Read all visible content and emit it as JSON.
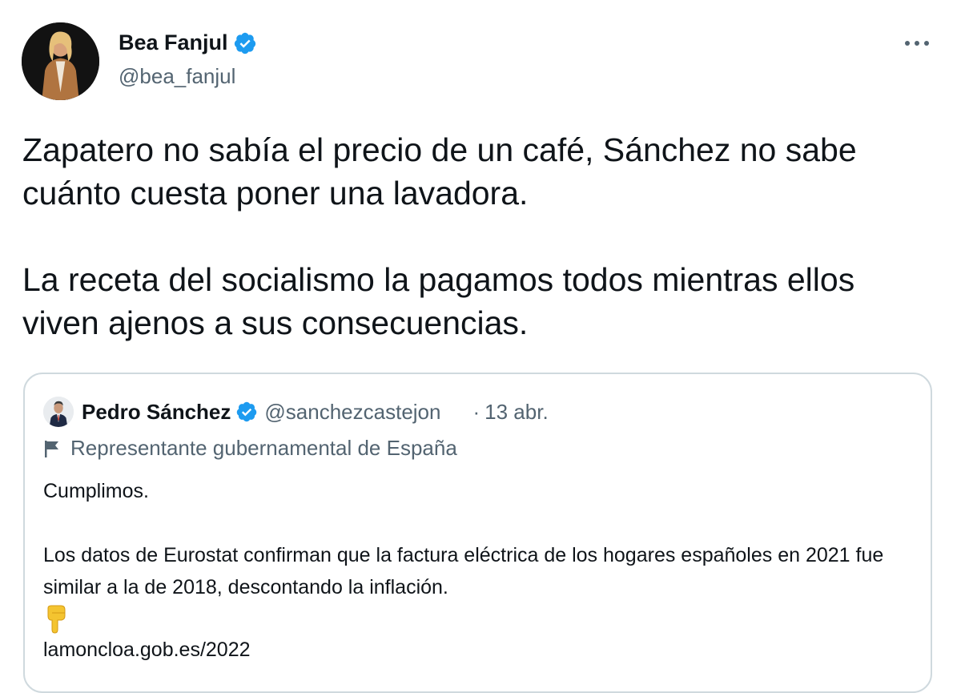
{
  "tweet": {
    "author_name": "Bea Fanjul",
    "author_handle": "@bea_fanjul",
    "paragraphs": [
      "Zapatero no sabía el precio de un café, Sánchez no sabe cuánto cuesta poner una lavadora.",
      "La receta del socialismo la pagamos todos mientras ellos viven ajenos a sus consecuencias."
    ],
    "more_icon": "more-horizontal-icon",
    "verified_icon": "verified-badge-icon"
  },
  "quoted_tweet": {
    "author_name": "Pedro Sánchez",
    "author_handle": "@sanchezcastejon",
    "separator": "·",
    "date": "13 abr.",
    "label": "Representante gubernamental de España",
    "label_icon": "flag-icon",
    "paragraphs": [
      "Cumplimos.",
      "Los datos de Eurostat confirman que la factura eléctrica de los hogares españoles en 2021 fue similar a la de 2018, descontando la inflación."
    ],
    "emoji": "pointing-down-hand-icon",
    "link_partial": "lamoncloa.gob.es/2022"
  },
  "colors": {
    "text_primary": "#0f1419",
    "text_secondary": "#536471",
    "verified_blue": "#1d9bf0",
    "border": "#cfd9de"
  }
}
